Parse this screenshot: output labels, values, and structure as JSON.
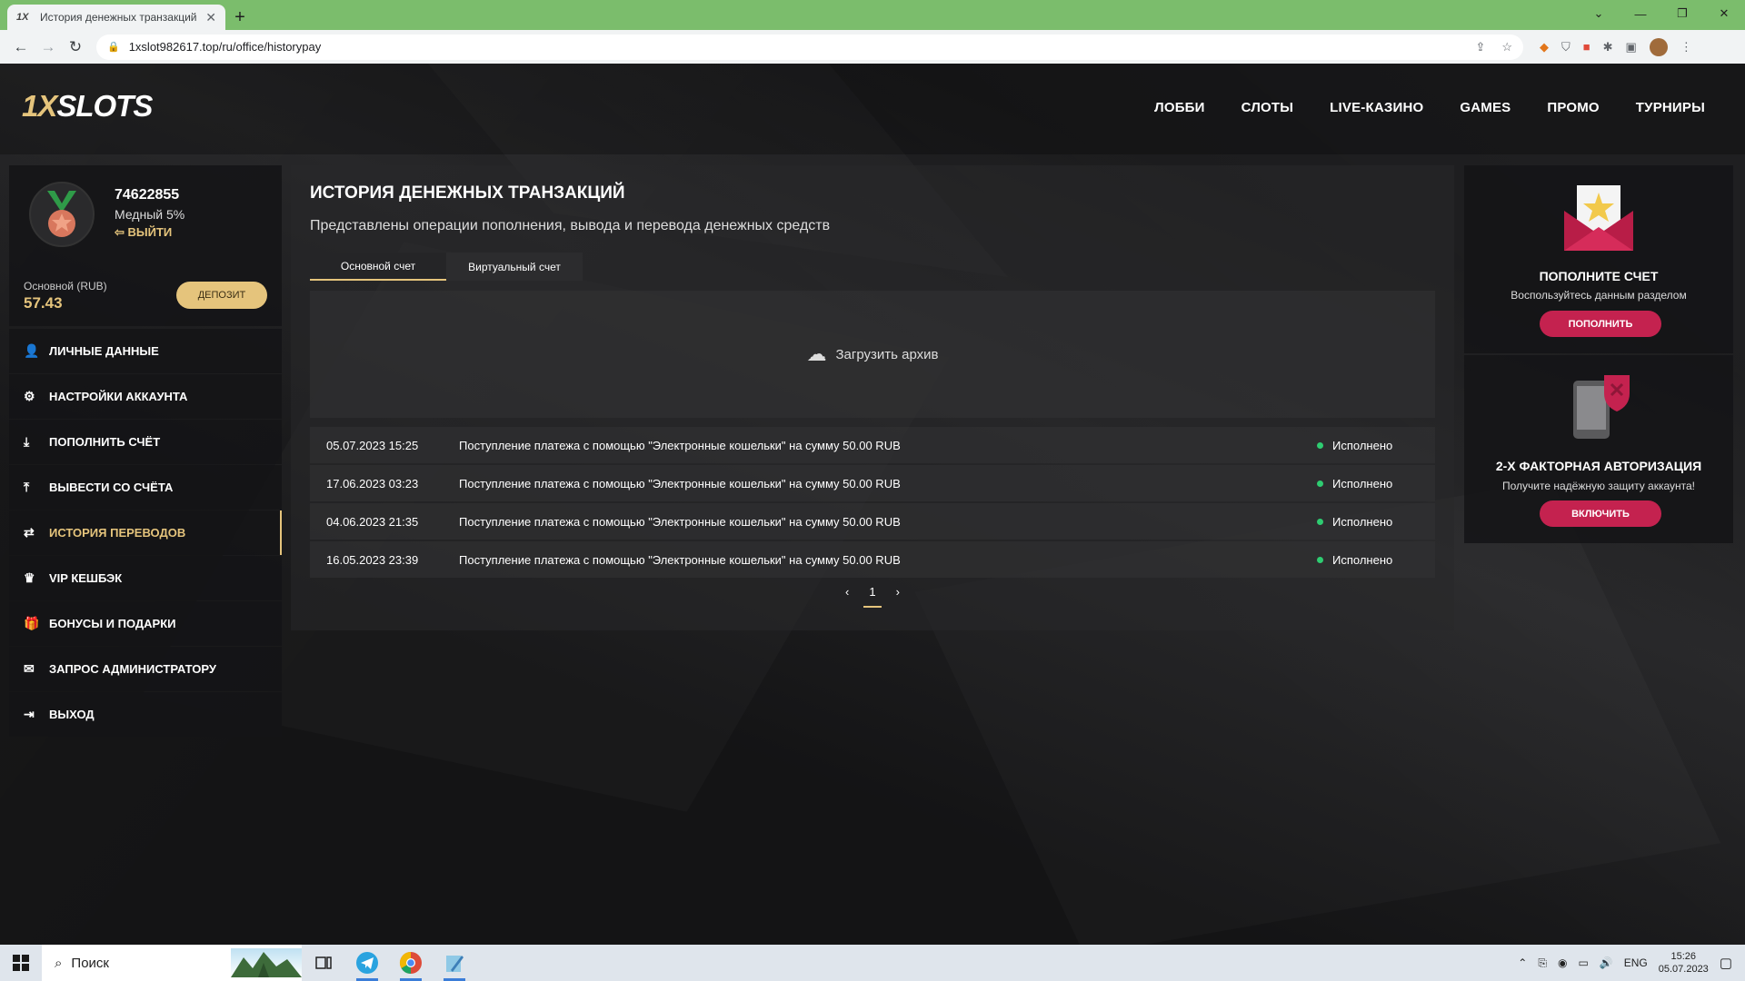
{
  "browser": {
    "tab_title": "История денежных транзакций",
    "tab_favicon": "1X",
    "url": "1xslot982617.top/ru/office/historypay"
  },
  "site": {
    "logo_prefix": "1X",
    "logo_main": "SLOTS",
    "nav": [
      "ЛОББИ",
      "СЛОТЫ",
      "LIVE-КАЗИНО",
      "GAMES",
      "ПРОМО",
      "ТУРНИРЫ"
    ]
  },
  "profile": {
    "user_id": "74622855",
    "rank": "Медный 5%",
    "logout_label": "ВЫЙТИ",
    "balance_label": "Основной (RUB)",
    "balance": "57.43",
    "deposit_label": "Депозит"
  },
  "menu": [
    {
      "label": "ЛИЧНЫЕ ДАННЫЕ",
      "icon": "user-icon",
      "glyph": "👤"
    },
    {
      "label": "НАСТРОЙКИ АККАУНТА",
      "icon": "settings-icon",
      "glyph": "⚙"
    },
    {
      "label": "ПОПОЛНИТЬ СЧЁТ",
      "icon": "download-icon",
      "glyph": "⤓"
    },
    {
      "label": "ВЫВЕСТИ СО СЧЁТА",
      "icon": "upload-icon",
      "glyph": "⤒"
    },
    {
      "label": "ИСТОРИЯ ПЕРЕВОДОВ",
      "icon": "transfer-icon",
      "glyph": "⇄",
      "active": true
    },
    {
      "label": "VIP КЕШБЭК",
      "icon": "crown-icon",
      "glyph": "♛"
    },
    {
      "label": "БОНУСЫ И ПОДАРКИ",
      "icon": "gift-icon",
      "glyph": "🎁"
    },
    {
      "label": "ЗАПРОС АДМИНИСТРАТОРУ",
      "icon": "mail-icon",
      "glyph": "✉"
    },
    {
      "label": "ВЫХОД",
      "icon": "exit-icon",
      "glyph": "⇥"
    }
  ],
  "main": {
    "title": "ИСТОРИЯ ДЕНЕЖНЫХ ТРАНЗАКЦИЙ",
    "subtitle": "Представлены операции пополнения, вывода и перевода денежных средств",
    "tabs": [
      {
        "label": "Основной счет",
        "active": true
      },
      {
        "label": "Виртуальный счет",
        "active": false
      }
    ],
    "archive_label": "Загрузить архив",
    "transactions": [
      {
        "date": "05.07.2023 15:25",
        "text": "Поступление платежа с помощью \"Электронные кошельки\" на сумму 50.00 RUB",
        "status": "Исполнено"
      },
      {
        "date": "17.06.2023 03:23",
        "text": "Поступление платежа с помощью \"Электронные кошельки\" на сумму 50.00 RUB",
        "status": "Исполнено"
      },
      {
        "date": "04.06.2023 21:35",
        "text": "Поступление платежа с помощью \"Электронные кошельки\" на сумму 50.00 RUB",
        "status": "Исполнено"
      },
      {
        "date": "16.05.2023 23:39",
        "text": "Поступление платежа с помощью \"Электронные кошельки\" на сумму 50.00 RUB",
        "status": "Исполнено"
      }
    ],
    "pager": {
      "prev": "‹",
      "current": "1",
      "next": "›"
    }
  },
  "promos": [
    {
      "title": "ПОПОЛНИТЕ СЧЕТ",
      "desc": "Воспользуйтесь данным разделом",
      "button": "ПОПОЛНИТЬ"
    },
    {
      "title": "2-Х ФАКТОРНАЯ АВТОРИЗАЦИЯ",
      "desc": "Получите надёжную защиту аккаунта!",
      "button": "ВКЛЮЧИТЬ"
    }
  ],
  "taskbar": {
    "search_placeholder": "Поиск",
    "lang": "ENG",
    "time": "15:26",
    "date": "05.07.2023"
  },
  "colors": {
    "accent": "#e5c47c",
    "promo_button": "#c4224f",
    "status_ok": "#2ecc71",
    "chrome_tabbar": "#7bbd6c"
  }
}
